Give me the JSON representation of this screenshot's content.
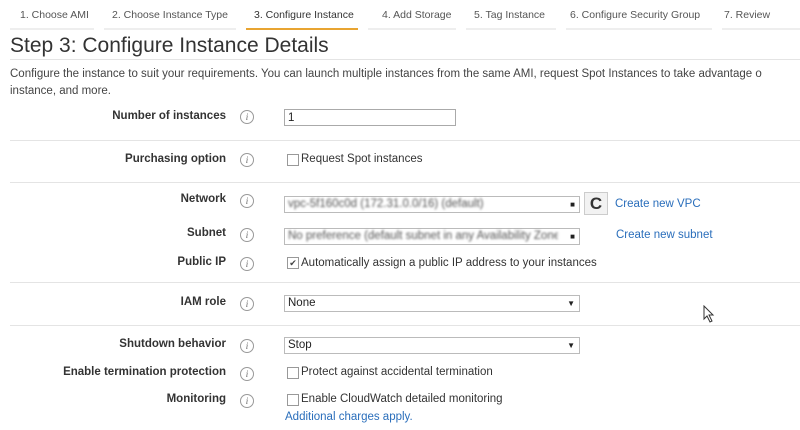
{
  "tabs": [
    {
      "label": "1. Choose AMI"
    },
    {
      "label": "2. Choose Instance Type"
    },
    {
      "label": "3. Configure Instance",
      "active": true
    },
    {
      "label": "4. Add Storage"
    },
    {
      "label": "5. Tag Instance"
    },
    {
      "label": "6. Configure Security Group"
    },
    {
      "label": "7. Review"
    }
  ],
  "title": "Step 3: Configure Instance Details",
  "description": [
    "Configure the instance to suit your requirements. You can launch multiple instances from the same AMI, request Spot Instances to take advantage o",
    "instance, and more."
  ],
  "info_glyph": "i",
  "fields": {
    "number_of_instances": {
      "label": "Number of instances",
      "value": "1"
    },
    "purchasing_option": {
      "label": "Purchasing option",
      "checkbox": "Request Spot instances",
      "checked": false
    },
    "network": {
      "label": "Network",
      "value": "vpc-5f160c0d (172.31.0.0/16) (default)",
      "link": "Create new VPC",
      "refresh_glyph": "C"
    },
    "subnet": {
      "label": "Subnet",
      "value": "No preference (default subnet in any Availability Zone)",
      "link": "Create new subnet"
    },
    "public_ip": {
      "label": "Public IP",
      "checkbox": "Automatically assign a public IP address to your instances",
      "checked": true
    },
    "iam_role": {
      "label": "IAM role",
      "value": "None"
    },
    "shutdown_behavior": {
      "label": "Shutdown behavior",
      "value": "Stop"
    },
    "termination_protection": {
      "label": "Enable termination protection",
      "checkbox": "Protect against accidental termination",
      "checked": false
    },
    "monitoring": {
      "label": "Monitoring",
      "checkbox": "Enable CloudWatch detailed monitoring",
      "checked": false,
      "note": "Additional charges apply."
    }
  }
}
